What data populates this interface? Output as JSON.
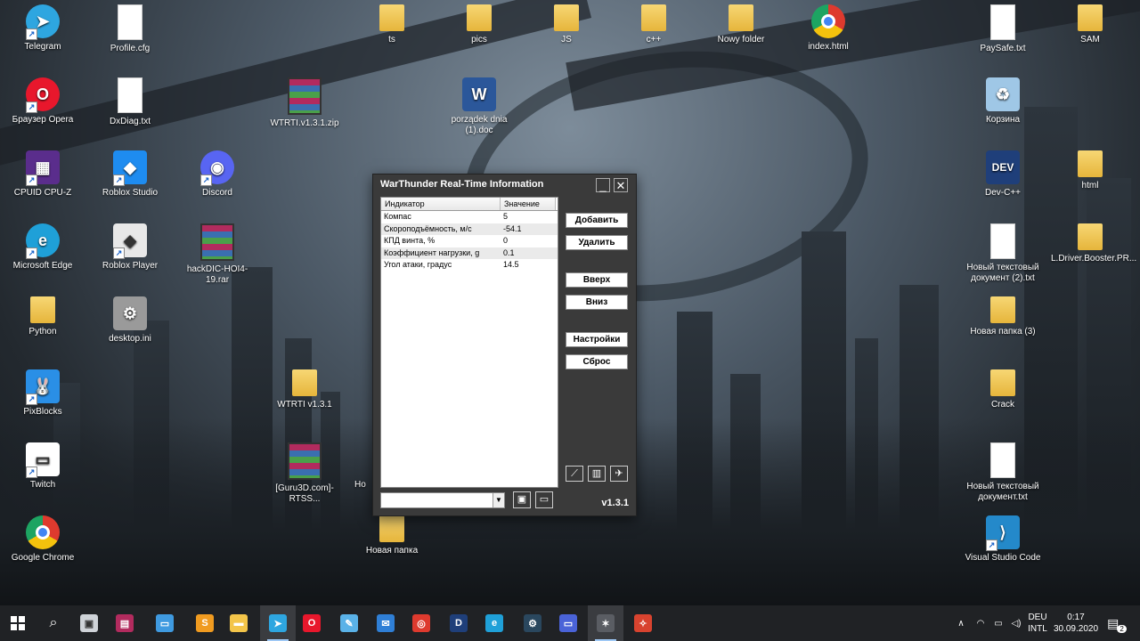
{
  "desktop": {
    "icons": [
      {
        "label": "Telegram",
        "icon": "telegram-icon",
        "color": "#2ea6e0",
        "letter": "➤"
      },
      {
        "label": "Profile.cfg",
        "icon": "file-icon"
      },
      {
        "label": "ts",
        "icon": "folder-icon"
      },
      {
        "label": "pics",
        "icon": "folder-icon"
      },
      {
        "label": "JS",
        "icon": "folder-icon"
      },
      {
        "label": "c++",
        "icon": "folder-icon"
      },
      {
        "label": "Nowy folder",
        "icon": "folder-icon"
      },
      {
        "label": "index.html",
        "icon": "chrome-icon"
      },
      {
        "label": "PaySafe.txt",
        "icon": "file-icon"
      },
      {
        "label": "SAM",
        "icon": "folder-icon"
      },
      {
        "label": "Браузер Opera",
        "icon": "opera-icon",
        "color": "#e8172c",
        "letter": "O"
      },
      {
        "label": "DxDiag.txt",
        "icon": "file-icon"
      },
      {
        "label": "WTRTI.v1.3.1.zip",
        "icon": "winrar-icon"
      },
      {
        "label": "porządek dnia (1).doc",
        "icon": "word-icon",
        "color": "#2b579a",
        "letter": "W"
      },
      {
        "label": "Корзина",
        "icon": "recycle-bin-icon",
        "color": "#9fc7e6",
        "letter": "♻"
      },
      {
        "label": "CPUID CPU-Z",
        "icon": "cpuz-icon",
        "color": "#5a2d8c",
        "letter": "▦"
      },
      {
        "label": "Roblox Studio",
        "icon": "roblox-studio-icon",
        "color": "#1e8cf0",
        "letter": "◆"
      },
      {
        "label": "Discord",
        "icon": "discord-icon",
        "color": "#5865f2",
        "letter": "◉"
      },
      {
        "label": "Dev-C++",
        "icon": "devcpp-icon",
        "color": "#1f3f7a",
        "letter": "DEV"
      },
      {
        "label": "html",
        "icon": "folder-icon"
      },
      {
        "label": "Microsoft Edge",
        "icon": "edge-icon",
        "color": "#1fa0d8",
        "letter": "e"
      },
      {
        "label": "Roblox Player",
        "icon": "roblox-player-icon",
        "color": "#e8e8e8",
        "letter": "◆"
      },
      {
        "label": "hackDIC-HOI4-19.rar",
        "icon": "winrar-icon"
      },
      {
        "label": "Новый текстовый документ (2).txt",
        "icon": "file-icon"
      },
      {
        "label": "L.Driver.Booster.PR...",
        "icon": "folder-icon"
      },
      {
        "label": "Python",
        "icon": "folder-icon"
      },
      {
        "label": "desktop.ini",
        "icon": "settings-file-icon",
        "color": "#9a9a9a",
        "letter": "⚙"
      },
      {
        "label": "Новая папка (3)",
        "icon": "folder-icon"
      },
      {
        "label": "PixBlocks",
        "icon": "pixblocks-icon",
        "color": "#2a8fe6",
        "letter": "🐰"
      },
      {
        "label": "WTRTI v1.3.1",
        "icon": "folder-icon"
      },
      {
        "label": "Crack",
        "icon": "folder-icon"
      },
      {
        "label": "Twitch",
        "icon": "twitch-icon",
        "color": "#ffffff",
        "letter": "▭"
      },
      {
        "label": "[Guru3D.com]-RTSS...",
        "icon": "winrar-icon"
      },
      {
        "label": "Ho",
        "icon": "hidden-icon"
      },
      {
        "label": "Новый текстовый документ.txt",
        "icon": "file-icon"
      },
      {
        "label": "Google Chrome",
        "icon": "chrome-icon"
      },
      {
        "label": "Новая папка",
        "icon": "folder-icon"
      },
      {
        "label": "Visual Studio Code",
        "icon": "vscode-icon",
        "color": "#2489ca",
        "letter": "⟩"
      }
    ]
  },
  "app": {
    "title": "WarThunder Real-Time Information",
    "minimize_label": "_",
    "close_label": "✕",
    "table": {
      "headers": [
        "Индикатор",
        "Значение"
      ],
      "rows": [
        [
          "Компас",
          "5"
        ],
        [
          "Скороподъёмность, м/с",
          "-54.1"
        ],
        [
          "КПД винта, %",
          "0"
        ],
        [
          "Коэффициент нагрузки, g",
          "0.1"
        ],
        [
          "Угол атаки, градус",
          "14.5"
        ]
      ]
    },
    "buttons": {
      "add": "Добавить",
      "delete": "Удалить",
      "up": "Вверх",
      "down": "Вниз",
      "settings": "Настройки",
      "reset": "Сброс"
    },
    "small_icons": [
      "graph-icon",
      "list-icon",
      "plane-icon"
    ],
    "combo_value": "",
    "version": "v1.3.1"
  },
  "taskbar": {
    "apps": [
      {
        "name": "task-view",
        "icon": "task-view-icon",
        "color": "#cfd3d8",
        "letter": "▣"
      },
      {
        "name": "winrar",
        "icon": "winrar-icon",
        "color": "#b22b5e",
        "letter": "▤"
      },
      {
        "name": "explorer-network",
        "icon": "network-icon",
        "color": "#3f9ae0",
        "letter": "▭"
      },
      {
        "name": "sublime",
        "icon": "sublime-icon",
        "color": "#f09b20",
        "letter": "S"
      },
      {
        "name": "file-explorer",
        "icon": "folder-icon",
        "color": "#f3c54a",
        "letter": "▬"
      },
      {
        "name": "telegram",
        "icon": "telegram-icon",
        "color": "#2ea6e0",
        "letter": "➤"
      },
      {
        "name": "opera",
        "icon": "opera-icon",
        "color": "#e8172c",
        "letter": "O"
      },
      {
        "name": "notepad",
        "icon": "notepad-icon",
        "color": "#5ab2e8",
        "letter": "✎"
      },
      {
        "name": "mail",
        "icon": "mail-icon",
        "color": "#2f7fd6",
        "letter": "✉"
      },
      {
        "name": "chrome",
        "icon": "chrome-icon",
        "color": "#de3a2e",
        "letter": "◎"
      },
      {
        "name": "devcpp",
        "icon": "devcpp-icon",
        "color": "#1f3f7a",
        "letter": "D"
      },
      {
        "name": "edge",
        "icon": "edge-icon",
        "color": "#1fa0d8",
        "letter": "e"
      },
      {
        "name": "steam",
        "icon": "steam-icon",
        "color": "#2a475e",
        "letter": "⚙"
      },
      {
        "name": "remote-desktop",
        "icon": "monitor-icon",
        "color": "#4a63d8",
        "letter": "▭"
      },
      {
        "name": "warthunder",
        "icon": "warthunder-icon",
        "color": "#5a5d63",
        "letter": "✶"
      },
      {
        "name": "wtrti",
        "icon": "wtrti-icon",
        "color": "#d8432f",
        "letter": "✧"
      }
    ],
    "lang_top": "DEU",
    "lang_bottom": "INTL",
    "time": "0:17",
    "date": "30.09.2020",
    "notification_count": "2"
  }
}
